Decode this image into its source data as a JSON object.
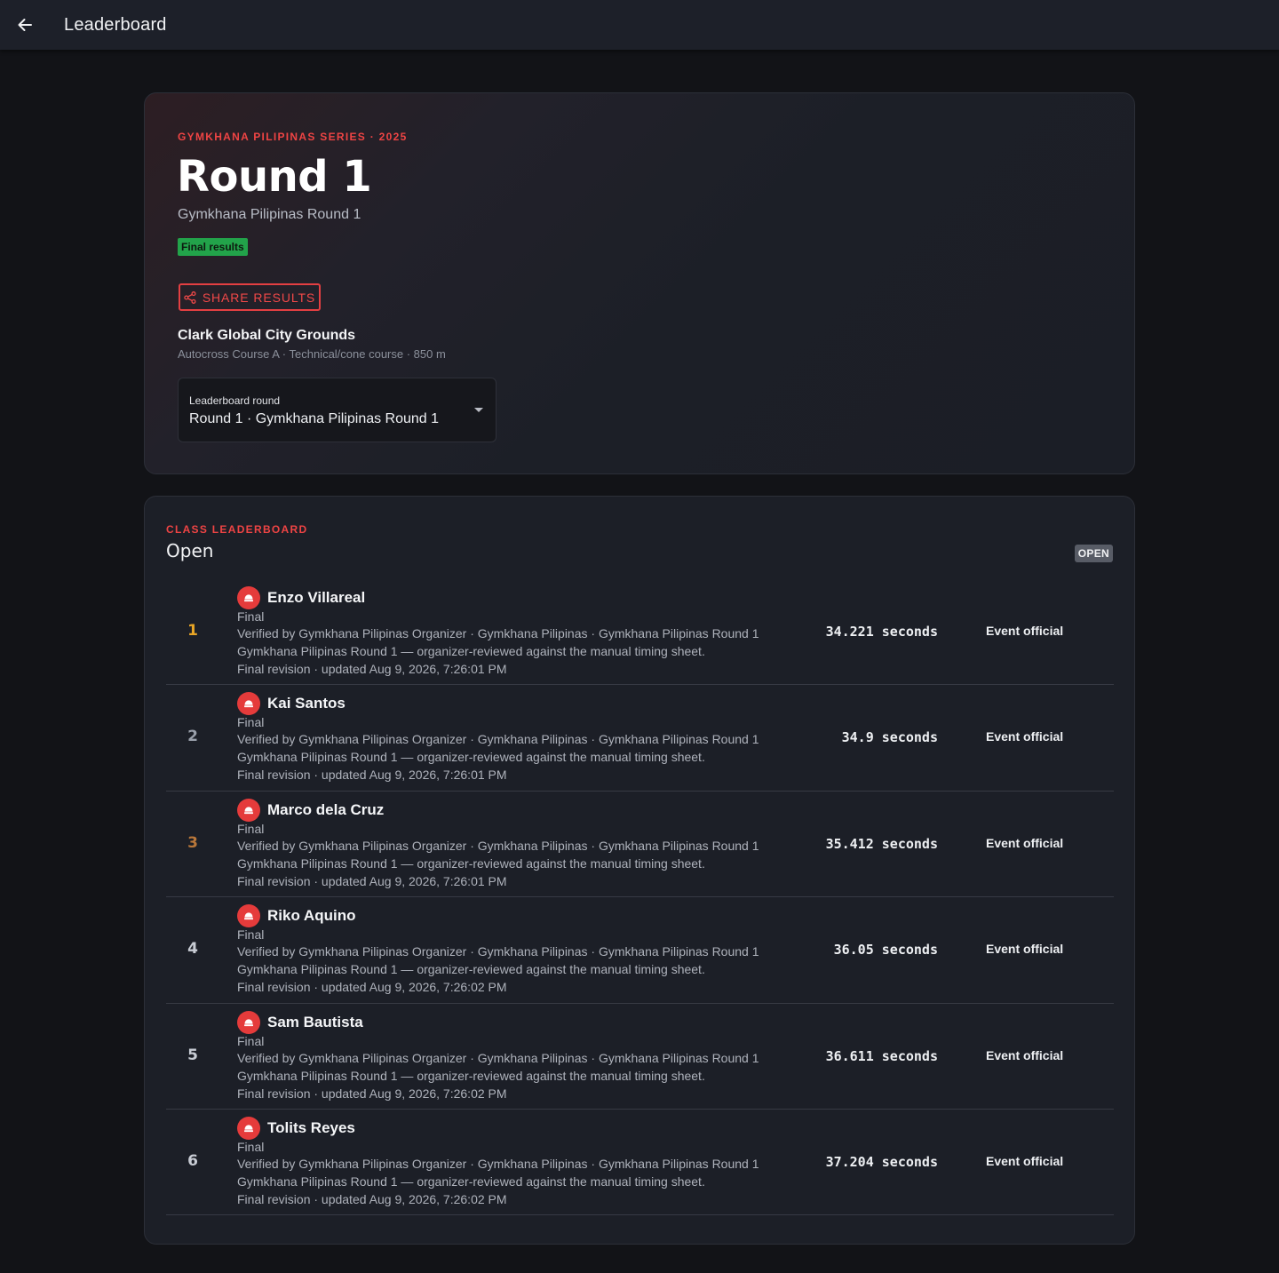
{
  "appbar": {
    "title": "Leaderboard"
  },
  "hero": {
    "series": "GYMKHANA PILIPINAS SERIES · 2025",
    "title": "Round 1",
    "subtitle": "Gymkhana Pilipinas Round 1",
    "status_badge": "Final results",
    "share_label": "SHARE RESULTS",
    "venue": "Clark Global City Grounds",
    "venue_meta": "Autocross Course A · Technical/cone course · 850 m",
    "round_select": {
      "label": "Leaderboard round",
      "value": "Round 1 · Gymkhana Pilipinas Round 1"
    }
  },
  "board": {
    "eyebrow": "CLASS LEADERBOARD",
    "class_name": "Open",
    "class_badge": "OPEN",
    "rows": [
      {
        "rank": "1",
        "rank_color": "#e8a526",
        "driver": "Enzo Villareal",
        "status": "Final",
        "verified": "Verified by Gymkhana Pilipinas Organizer · Gymkhana Pilipinas · Gymkhana Pilipinas Round 1",
        "note": "Gymkhana Pilipinas Round 1 — organizer-reviewed against the manual timing sheet.",
        "revision": "Final revision · updated Aug 9, 2026, 7:26:01 PM",
        "time": "34.221 seconds",
        "source": "Event official"
      },
      {
        "rank": "2",
        "rank_color": "#9aa0ab",
        "driver": "Kai Santos",
        "status": "Final",
        "verified": "Verified by Gymkhana Pilipinas Organizer · Gymkhana Pilipinas · Gymkhana Pilipinas Round 1",
        "note": "Gymkhana Pilipinas Round 1 — organizer-reviewed against the manual timing sheet.",
        "revision": "Final revision · updated Aug 9, 2026, 7:26:01 PM",
        "time": "34.9 seconds",
        "source": "Event official"
      },
      {
        "rank": "3",
        "rank_color": "#b9773a",
        "driver": "Marco dela Cruz",
        "status": "Final",
        "verified": "Verified by Gymkhana Pilipinas Organizer · Gymkhana Pilipinas · Gymkhana Pilipinas Round 1",
        "note": "Gymkhana Pilipinas Round 1 — organizer-reviewed against the manual timing sheet.",
        "revision": "Final revision · updated Aug 9, 2026, 7:26:01 PM",
        "time": "35.412 seconds",
        "source": "Event official"
      },
      {
        "rank": "4",
        "rank_color": "#c8ccd4",
        "driver": "Riko Aquino",
        "status": "Final",
        "verified": "Verified by Gymkhana Pilipinas Organizer · Gymkhana Pilipinas · Gymkhana Pilipinas Round 1",
        "note": "Gymkhana Pilipinas Round 1 — organizer-reviewed against the manual timing sheet.",
        "revision": "Final revision · updated Aug 9, 2026, 7:26:02 PM",
        "time": "36.05 seconds",
        "source": "Event official"
      },
      {
        "rank": "5",
        "rank_color": "#c8ccd4",
        "driver": "Sam Bautista",
        "status": "Final",
        "verified": "Verified by Gymkhana Pilipinas Organizer · Gymkhana Pilipinas · Gymkhana Pilipinas Round 1",
        "note": "Gymkhana Pilipinas Round 1 — organizer-reviewed against the manual timing sheet.",
        "revision": "Final revision · updated Aug 9, 2026, 7:26:02 PM",
        "time": "36.611 seconds",
        "source": "Event official"
      },
      {
        "rank": "6",
        "rank_color": "#c8ccd4",
        "driver": "Tolits Reyes",
        "status": "Final",
        "verified": "Verified by Gymkhana Pilipinas Organizer · Gymkhana Pilipinas · Gymkhana Pilipinas Round 1",
        "note": "Gymkhana Pilipinas Round 1 — organizer-reviewed against the manual timing sheet.",
        "revision": "Final revision · updated Aug 9, 2026, 7:26:02 PM",
        "time": "37.204 seconds",
        "source": "Event official"
      }
    ]
  },
  "icons": {
    "back": "arrow-left-icon",
    "share": "share-icon",
    "avatar": "helmet-icon",
    "dropdown": "caret-down-icon"
  },
  "colors": {
    "accent": "#ef4444",
    "final_badge": "#22a34a",
    "background": "#121317",
    "card": "#1c1f27"
  }
}
